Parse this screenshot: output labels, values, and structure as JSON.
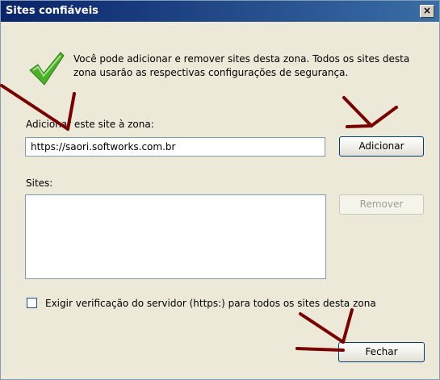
{
  "window": {
    "title": "Sites confiáveis",
    "close_label": "×"
  },
  "intro_text": "Você pode adicionar e remover sites desta zona. Todos os sites desta zona usarão as respectivas configurações de segurança.",
  "add_site": {
    "label": "Adicionar este site à zona:",
    "value": "https://saori.softworks.com.br",
    "button_label": "Adicionar"
  },
  "sites": {
    "label": "Sites:",
    "items": [],
    "remove_label": "Remover"
  },
  "require_https": {
    "label": "Exigir verificação do servidor (https:) para todos os sites desta zona",
    "checked": false
  },
  "close_button_label": "Fechar",
  "colors": {
    "title_bar": "#0a246a",
    "annotation_arrows": "#7a0000",
    "check_mark": "#4caf2a"
  }
}
